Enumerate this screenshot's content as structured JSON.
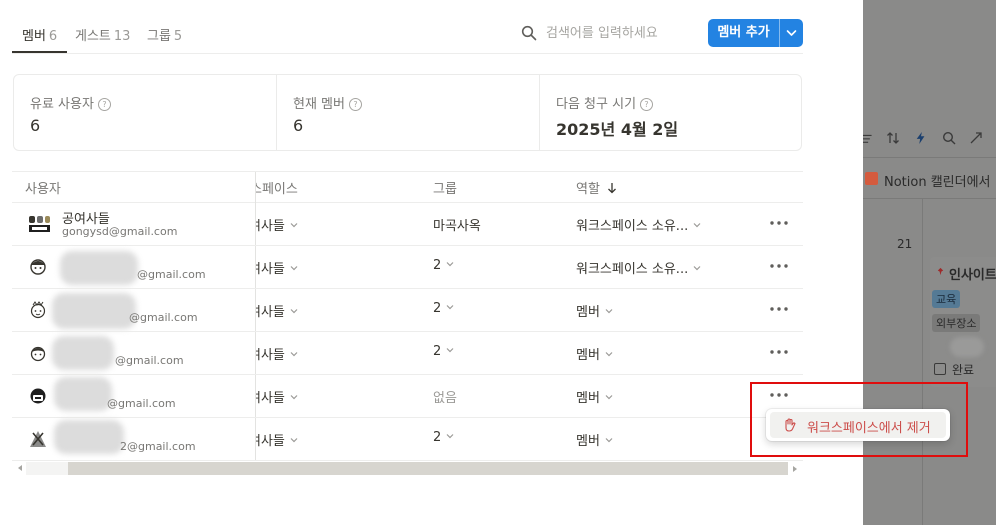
{
  "tabs": [
    {
      "label": "멤버",
      "count": "6"
    },
    {
      "label": "게스트",
      "count": "13"
    },
    {
      "label": "그룹",
      "count": "5"
    }
  ],
  "search": {
    "placeholder": "검색어를 입력하세요",
    "icon": "search-icon"
  },
  "add_member_button": {
    "label": "멤버 추가",
    "color": "#2383e2"
  },
  "stats": [
    {
      "label": "유료 사용자",
      "value": "6"
    },
    {
      "label": "현재 멤버",
      "value": "6"
    },
    {
      "label": "다음 청구 시기",
      "value": "2025년 4월 2일"
    }
  ],
  "table": {
    "columns": {
      "user": "사용자",
      "workspace": "스페이스",
      "groups": "그룹",
      "role": "역할"
    },
    "rows": [
      {
        "name": "공여사들",
        "email": "gongysd@gmail.com",
        "workspace": "여사들",
        "groups": "마곡사옥",
        "role": "워크스페이스 소유..."
      },
      {
        "name": "",
        "email": "@gmail.com",
        "workspace": "여사들",
        "groups": "2",
        "role": "워크스페이스 소유..."
      },
      {
        "name": "",
        "email": "@gmail.com",
        "workspace": "여사들",
        "groups": "2",
        "role": "멤버"
      },
      {
        "name": "",
        "email": "@gmail.com",
        "workspace": "여사들",
        "groups": "2",
        "role": "멤버"
      },
      {
        "name": "",
        "email": "@gmail.com",
        "workspace": "여사들",
        "groups": "없음",
        "role": "멤버"
      },
      {
        "name": "",
        "email": "2@gmail.com",
        "workspace": "여사들",
        "groups": "2",
        "role": "멤버"
      }
    ]
  },
  "context_menu": {
    "remove_label": "워크스페이스에서 제거",
    "color": "#cc4d4a"
  },
  "background_page": {
    "calendar_label": "Notion 캘린더에서",
    "day_number": "21",
    "card_title": "인사이트",
    "tags": [
      "교육",
      "외부장소"
    ],
    "checkbox_label": "완료"
  }
}
